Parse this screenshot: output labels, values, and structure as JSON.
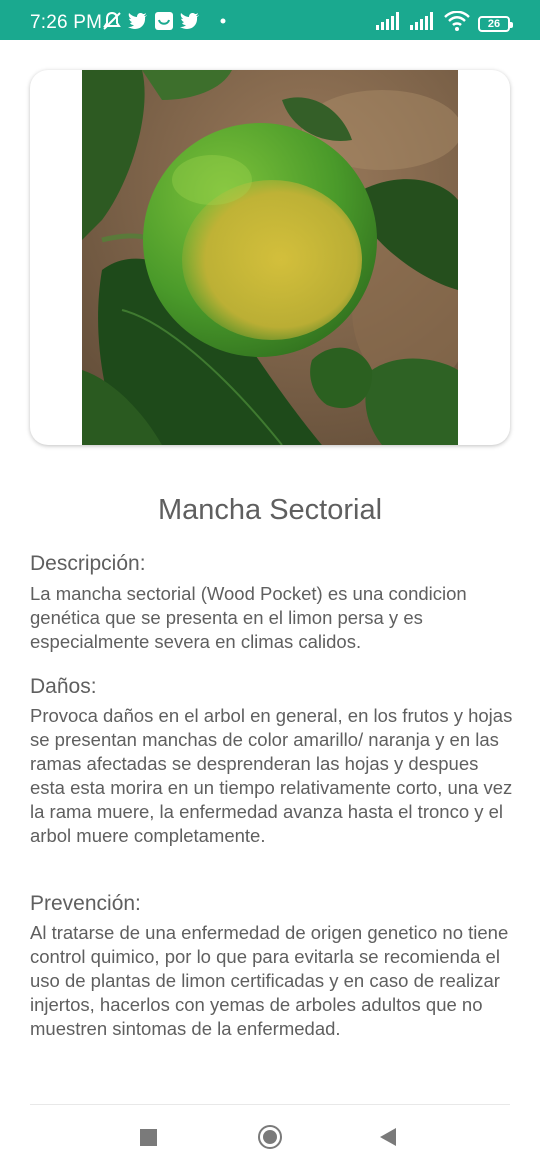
{
  "status_bar": {
    "time": "7:26 PM",
    "battery": "26",
    "icons_left": [
      "muted-bell-icon",
      "twitter-icon",
      "app-icon",
      "twitter-icon",
      "dot-icon"
    ],
    "icons_right": [
      "signal-icon",
      "signal-icon",
      "wifi-icon",
      "battery-icon"
    ]
  },
  "disease": {
    "title": "Mancha Sectorial",
    "image_alt": "lime-fruit-photo"
  },
  "sections": {
    "description": {
      "heading": "Descripción:",
      "body": "La mancha sectorial (Wood Pocket) es una condicion genética que se presenta en el limon persa y es especialmente severa en climas calidos."
    },
    "damage": {
      "heading": "Daños:",
      "body": "Provoca daños en el arbol en general, en los frutos y hojas se presentan manchas de color amarillo/ naranja y en las ramas afectadas se desprenderan las hojas y despues esta esta morira en un tiempo relativamente corto, una vez la rama muere, la enfermedad avanza hasta el tronco y el arbol muere completamente."
    },
    "prevention": {
      "heading": "Prevención:",
      "body": "Al tratarse de una enfermedad de origen genetico no tiene control quimico, por lo que para evitarla se recomienda el uso de plantas de limon certificadas y en caso de realizar injertos, hacerlos con yemas de arboles adultos que no muestren sintomas de la enfermedad."
    }
  },
  "nav": {
    "recents": "square-icon",
    "home": "circle-icon",
    "back": "triangle-icon"
  },
  "colors": {
    "status_bar": "#1aa98f",
    "text": "#5f5f5f"
  }
}
